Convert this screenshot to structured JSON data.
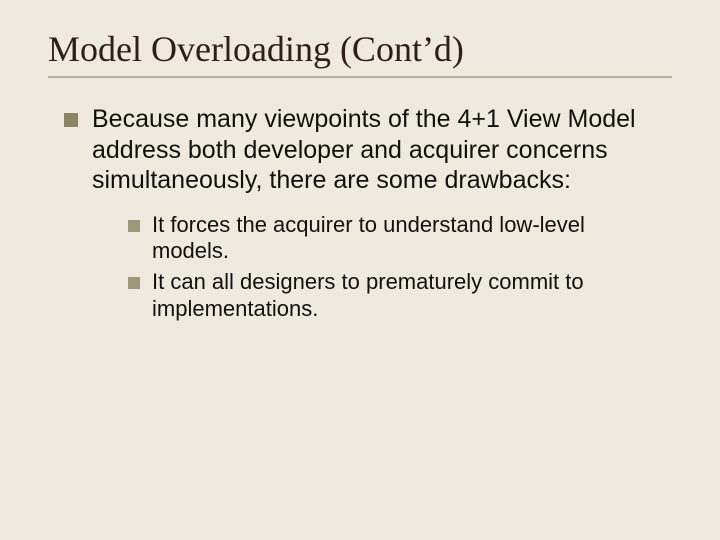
{
  "title": "Model Overloading (Cont’d)",
  "bullets": [
    {
      "text": "Because many viewpoints of the 4+1 View Model address both developer and acquirer concerns simultaneously, there are some drawbacks:",
      "children": [
        {
          "text": "It forces the acquirer to understand low-level models."
        },
        {
          "text": "It can all designers to prematurely commit to implementations."
        }
      ]
    }
  ]
}
